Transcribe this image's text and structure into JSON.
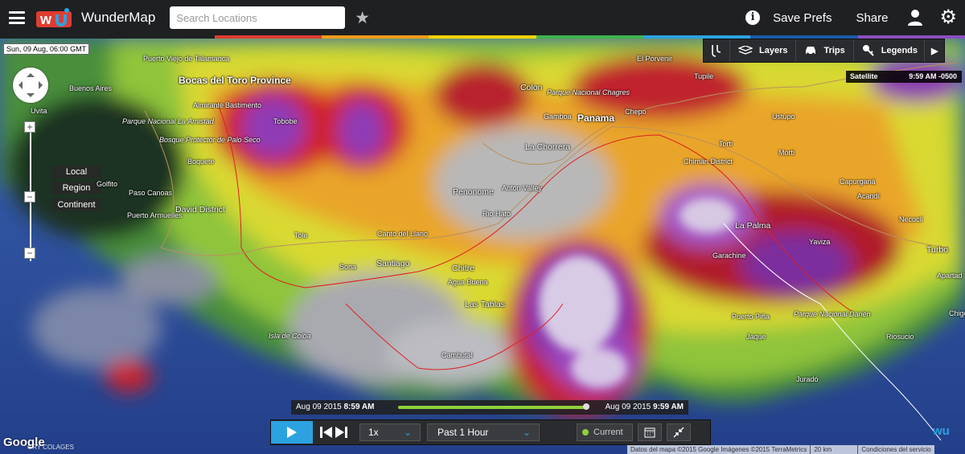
{
  "header": {
    "brand": "WunderMap",
    "search_placeholder": "Search Locations",
    "save_prefs": "Save Prefs",
    "share": "Share"
  },
  "accent_colors": [
    "#e03c31",
    "#f29b1d",
    "#ffd400",
    "#3fb34f",
    "#2ca3e0",
    "#1a5aa8",
    "#8a4fbf"
  ],
  "map": {
    "date_stamp": "Sun, 09 Aug, 06:00 GMT",
    "map_types": [
      "Local",
      "Region",
      "Continent"
    ],
    "toolbar": [
      "Layers",
      "Trips",
      "Legends"
    ],
    "satellite": {
      "label": "Satellite",
      "time": "9:59 AM -0500"
    },
    "places": [
      {
        "name": "Puerto Viejo de Talamanca",
        "kind": "town"
      },
      {
        "name": "Bocas del Toro Province",
        "kind": "big"
      },
      {
        "name": "Almirante",
        "kind": "town"
      },
      {
        "name": "Bastimento",
        "kind": "town"
      },
      {
        "name": "Tobobe",
        "kind": "town"
      },
      {
        "name": "Buenos Aires",
        "kind": "town"
      },
      {
        "name": "Uvita",
        "kind": "town"
      },
      {
        "name": "Parque Nacional La Amistad",
        "kind": "park"
      },
      {
        "name": "Bosque Protector de Palo Seco",
        "kind": "park"
      },
      {
        "name": "Boquete",
        "kind": "town"
      },
      {
        "name": "Golfito",
        "kind": "town"
      },
      {
        "name": "Paso Canoas",
        "kind": "town"
      },
      {
        "name": "Puerto Armuelles",
        "kind": "town"
      },
      {
        "name": "David District",
        "kind": "mid"
      },
      {
        "name": "Colon",
        "kind": "mid"
      },
      {
        "name": "Parque Nacional Chagres",
        "kind": "park"
      },
      {
        "name": "Gamboa",
        "kind": "town"
      },
      {
        "name": "Panama",
        "kind": "big"
      },
      {
        "name": "La Chorrera",
        "kind": "mid"
      },
      {
        "name": "Chepo",
        "kind": "town"
      },
      {
        "name": "El Porvenir",
        "kind": "town"
      },
      {
        "name": "Tupile",
        "kind": "town"
      },
      {
        "name": "Ustupo",
        "kind": "town"
      },
      {
        "name": "Torti",
        "kind": "town"
      },
      {
        "name": "Morti",
        "kind": "town"
      },
      {
        "name": "Chimán District",
        "kind": "town"
      },
      {
        "name": "Capurganá",
        "kind": "town"
      },
      {
        "name": "Acandí",
        "kind": "town"
      },
      {
        "name": "Necocli",
        "kind": "town"
      },
      {
        "name": "Turbo",
        "kind": "mid"
      },
      {
        "name": "Apartad",
        "kind": "town"
      },
      {
        "name": "Chigo",
        "kind": "town"
      },
      {
        "name": "Penonome",
        "kind": "mid"
      },
      {
        "name": "Anton Valley",
        "kind": "town"
      },
      {
        "name": "Rio Hato",
        "kind": "town"
      },
      {
        "name": "La Palma",
        "kind": "mid"
      },
      {
        "name": "Yaviza",
        "kind": "town"
      },
      {
        "name": "Garachine",
        "kind": "town"
      },
      {
        "name": "Tole",
        "kind": "town"
      },
      {
        "name": "Canto del Llano",
        "kind": "town"
      },
      {
        "name": "Sona",
        "kind": "town"
      },
      {
        "name": "Santiago",
        "kind": "mid"
      },
      {
        "name": "Chitre",
        "kind": "mid"
      },
      {
        "name": "Agua Buena",
        "kind": "town"
      },
      {
        "name": "Las Tablas",
        "kind": "mid"
      },
      {
        "name": "Isla de Coiba",
        "kind": "park"
      },
      {
        "name": "Cambutal",
        "kind": "town"
      },
      {
        "name": "Puerto Piña",
        "kind": "town"
      },
      {
        "name": "Parque Nacional Darién",
        "kind": "park"
      },
      {
        "name": "Jaque",
        "kind": "town"
      },
      {
        "name": "Riosucio",
        "kind": "town"
      },
      {
        "name": "Juradó",
        "kind": "town"
      }
    ],
    "google": "Google",
    "imagery_note": "GRY COLAGES",
    "attribution": [
      "Datos del mapa ©2015 Google Imágenes ©2015 TerraMetrics",
      "20 km",
      "Condiciones del servicio"
    ]
  },
  "timeline": {
    "start_date": "Aug 09 2015",
    "start_time": "8:59 AM",
    "end_date": "Aug 09 2015",
    "end_time": "9:59 AM",
    "progress": 1.0
  },
  "controls": {
    "speed": "1x",
    "range": "Past 1 Hour",
    "current": "Current"
  }
}
